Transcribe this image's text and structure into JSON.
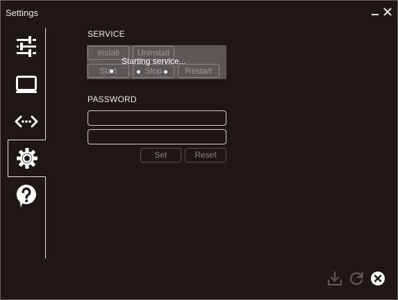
{
  "window": {
    "title": "Settings"
  },
  "nav": {
    "items": [
      {
        "icon": "sliders-icon",
        "active": false
      },
      {
        "icon": "display-icon",
        "active": false
      },
      {
        "icon": "network-icon",
        "active": false
      },
      {
        "icon": "gear-icon",
        "active": true
      },
      {
        "icon": "help-icon",
        "active": false
      }
    ]
  },
  "service": {
    "heading": "SERVICE",
    "install_label": "Install",
    "uninstall_label": "Uninstall",
    "start_label": "Start",
    "stop_label": "Stop",
    "restart_label": "Restart",
    "status_text": "Starting service..."
  },
  "password": {
    "heading": "PASSWORD",
    "field1_value": "",
    "field2_value": "",
    "set_label": "Set",
    "reset_label": "Reset"
  },
  "footer": {
    "icons": [
      "download-icon",
      "refresh-icon",
      "close-circle-icon"
    ]
  },
  "colors": {
    "background": "#1e1716",
    "foreground": "#e8e8e8",
    "panel_overlay": "#5b5757"
  }
}
